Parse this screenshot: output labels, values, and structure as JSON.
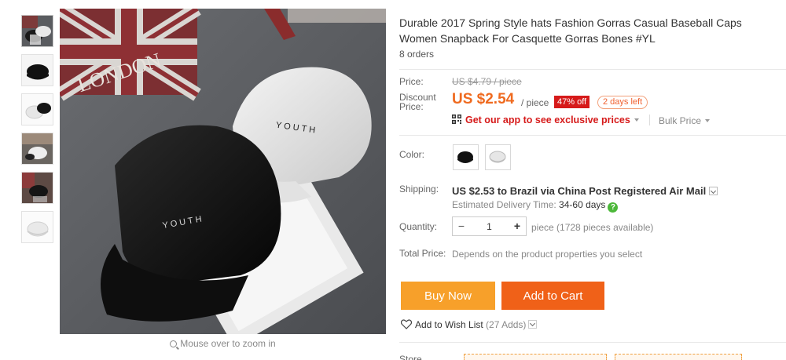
{
  "product": {
    "title": "Durable 2017 Spring Style hats Fashion Gorras Casual Baseball Caps Women Snapback For Casquette Gorras Bones #YL",
    "orders": "8 orders"
  },
  "gallery": {
    "zoom_hint": "Mouse over to zoom in",
    "thumbnails": [
      "thumb-1",
      "thumb-2",
      "thumb-3",
      "thumb-4",
      "thumb-5",
      "thumb-6"
    ],
    "image_text": {
      "cap_left": "YOUTH",
      "cap_right": "YOUTH",
      "flag_text": "LONDON"
    }
  },
  "pricing": {
    "price_label": "Price:",
    "original_price": "US $4.79 / piece",
    "discount_label_1": "Discount",
    "discount_label_2": "Price:",
    "current_price": "US $2.54",
    "unit": "/ piece",
    "discount_badge": "47% off",
    "time_left": "2 days left",
    "app_promo": "Get our app to see exclusive prices",
    "bulk_price": "Bulk Price"
  },
  "options": {
    "color_label": "Color:",
    "colors": [
      "black-cap",
      "white-cap"
    ]
  },
  "shipping": {
    "label": "Shipping:",
    "price": "US $2.53",
    "rest": "to Brazil via China Post Registered Air Mail",
    "estimate_label": "Estimated Delivery Time:",
    "estimate_days": "34-60 days"
  },
  "quantity": {
    "label": "Quantity:",
    "minus": "−",
    "plus": "+",
    "value": "1",
    "availability": "piece (1728 pieces available)"
  },
  "total": {
    "label": "Total Price:",
    "value": "Depends on the product properties you select"
  },
  "actions": {
    "buy_now": "Buy Now",
    "add_to_cart": "Add to Cart",
    "wishlist": "Add to Wish List",
    "wishlist_count": "(27 Adds)"
  },
  "store": {
    "label": "Store"
  },
  "colors": {
    "price_orange": "#ef6a1f",
    "buy_now_bg": "#f7a02a",
    "add_to_cart_bg": "#f06118",
    "badge_red": "#d61a1a"
  }
}
